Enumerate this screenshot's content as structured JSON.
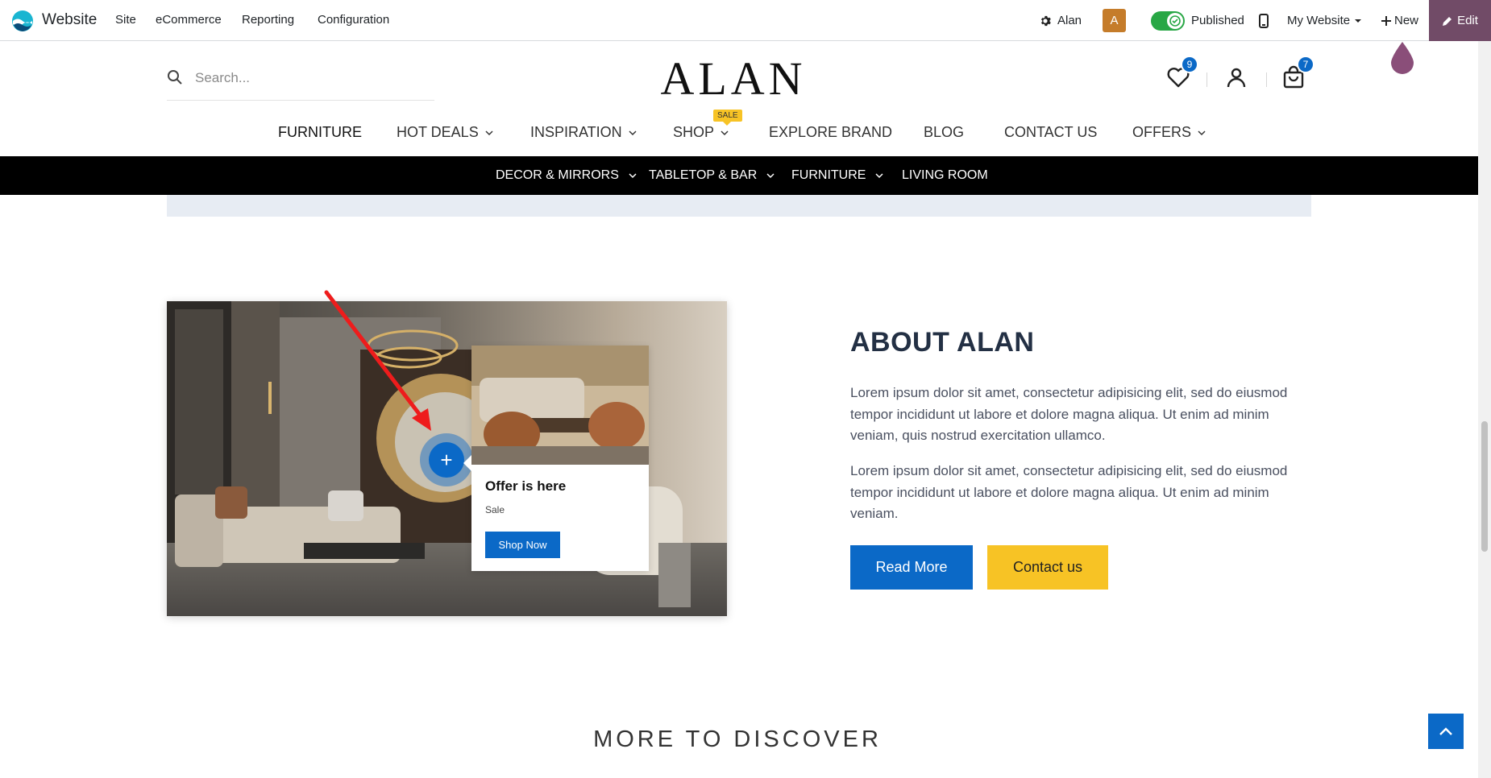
{
  "admin_bar": {
    "app_name": "Website",
    "menus": [
      "Site",
      "eCommerce",
      "Reporting",
      "Configuration"
    ],
    "user": "Alan",
    "avatar_letter": "A",
    "published_label": "Published",
    "website_selector": "My Website",
    "new_label": "New",
    "edit_label": "Edit"
  },
  "header": {
    "search_placeholder": "Search...",
    "brand": "ALAN",
    "wishlist_count": "9",
    "cart_count": "7"
  },
  "main_nav": {
    "items": [
      "FURNITURE",
      "HOT DEALS",
      "INSPIRATION",
      "SHOP",
      "EXPLORE BRAND",
      "BLOG",
      "CONTACT US",
      "OFFERS"
    ],
    "sale_tag": "SALE"
  },
  "sub_nav": {
    "items": [
      "DECOR & MIRRORS",
      "TABLETOP & BAR",
      "FURNITURE",
      "LIVING ROOM"
    ]
  },
  "hotspot_popup": {
    "plus": "+",
    "title": "Offer is here",
    "subtitle": "Sale",
    "button": "Shop Now"
  },
  "about": {
    "title": "ABOUT ALAN",
    "para1": "Lorem ipsum dolor sit amet, consectetur adipisicing elit, sed do eiusmod tempor incididunt ut labore et dolore magna aliqua. Ut enim ad minim veniam, quis nostrud exercitation ullamco.",
    "para2": "Lorem ipsum dolor sit amet, consectetur adipisicing elit, sed do eiusmod tempor incididunt ut labore et dolore magna aliqua. Ut enim ad minim veniam.",
    "read_more": "Read More",
    "contact": "Contact us"
  },
  "discover_title": "MORE TO DISCOVER",
  "colors": {
    "primary": "#0b69c7",
    "accent": "#f7c325",
    "odoo_purple": "#714b67",
    "toggle_green": "#28a745"
  }
}
